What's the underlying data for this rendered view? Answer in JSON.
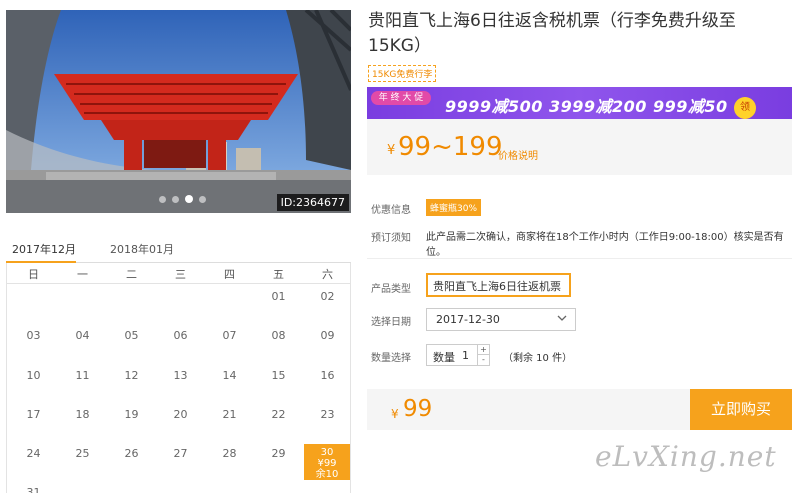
{
  "photo": {
    "id_badge": "ID:2364677",
    "slide_count": 4,
    "active_slide": 3
  },
  "calendar": {
    "tabs": [
      "2017年12月",
      "2018年01月"
    ],
    "active_tab": 0,
    "weekdays": [
      "日",
      "一",
      "二",
      "三",
      "四",
      "五",
      "六"
    ],
    "weeks": [
      [
        "",
        "",
        "",
        "",
        "",
        "01",
        "02"
      ],
      [
        "03",
        "04",
        "05",
        "06",
        "07",
        "08",
        "09"
      ],
      [
        "10",
        "11",
        "12",
        "13",
        "14",
        "15",
        "16"
      ],
      [
        "17",
        "18",
        "19",
        "20",
        "21",
        "22",
        "23"
      ],
      [
        "24",
        "25",
        "26",
        "27",
        "28",
        "29",
        "30"
      ],
      [
        "31",
        "",
        "",
        "",
        "",
        "",
        ""
      ]
    ],
    "selected_day": {
      "day": "30",
      "price": "¥99",
      "stock": "余10"
    }
  },
  "product": {
    "title": "贵阳直飞上海6日往返含税机票（行李免费升级至15KG）",
    "tag": "15KG免费行李",
    "banner": {
      "badge": "年 终 大 促",
      "text": "9999减500 3999减200 999减50",
      "coin": "领"
    },
    "price": {
      "currency": "¥",
      "range": "99~199",
      "note": "价格说明"
    },
    "promo": {
      "label": "优惠信息",
      "tag": "蜂蜜瓶30%"
    },
    "booking_notice": {
      "label": "预订须知",
      "text": "此产品需二次确认，商家将在18个工作小时内（工作日9:00-18:00）核实是否有位。"
    },
    "type": {
      "label": "产品类型",
      "value": "贵阳直飞上海6日往返机票"
    },
    "date": {
      "label": "选择日期",
      "value": "2017-12-30"
    },
    "quantity": {
      "label": "数量选择",
      "field_label": "数量",
      "value": "1",
      "plus": "+",
      "minus": "-",
      "stock_note": "（剩余 10 件）"
    },
    "total": {
      "currency": "¥",
      "value": "99"
    },
    "buy_label": "立即购买"
  },
  "watermark": "eLvXing.net"
}
